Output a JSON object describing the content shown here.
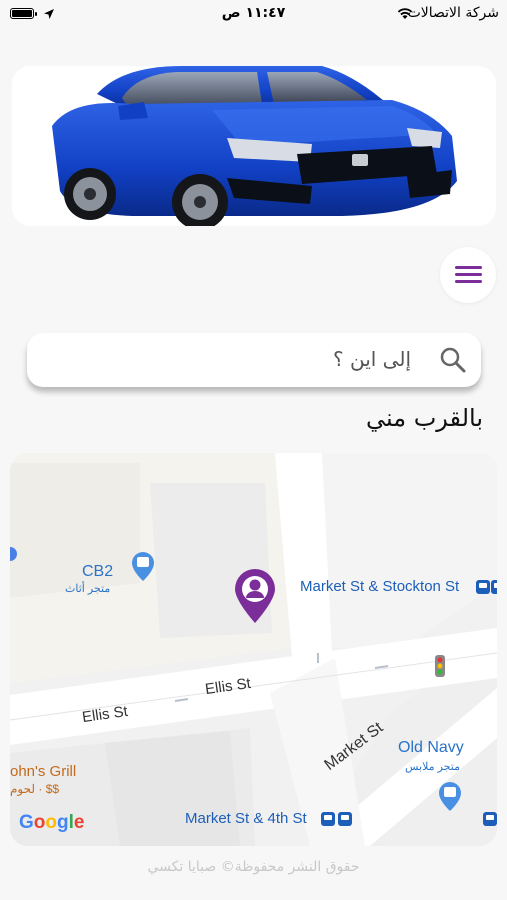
{
  "status_bar": {
    "time": "١١:٤٧ ص",
    "carrier": "شركة الاتصالات"
  },
  "search": {
    "placeholder": "إلى اين ؟"
  },
  "section": {
    "nearby_title": "بالقرب مني"
  },
  "map": {
    "labels": {
      "cb2": "CB2",
      "cb2_sub": "متجر أثاث",
      "market_stockton": "Market St & Stockton St",
      "ellis_1": "Ellis St",
      "ellis_2": "Ellis St",
      "market_st": "Market St",
      "old_navy": "Old Navy",
      "old_navy_sub": "متجر ملابس",
      "johns_grill": "ohn's Grill",
      "johns_grill_sub": "$$ · لحوم",
      "market_4th": "Market St & 4th St",
      "google": "Google"
    },
    "colors": {
      "pin": "#7b2d9a",
      "transit": "#1d5fb8"
    }
  },
  "footer": {
    "copyright": "حقوق النشر محفوظة© صبايا تكسي"
  },
  "accent_color": "#7b2d9a"
}
